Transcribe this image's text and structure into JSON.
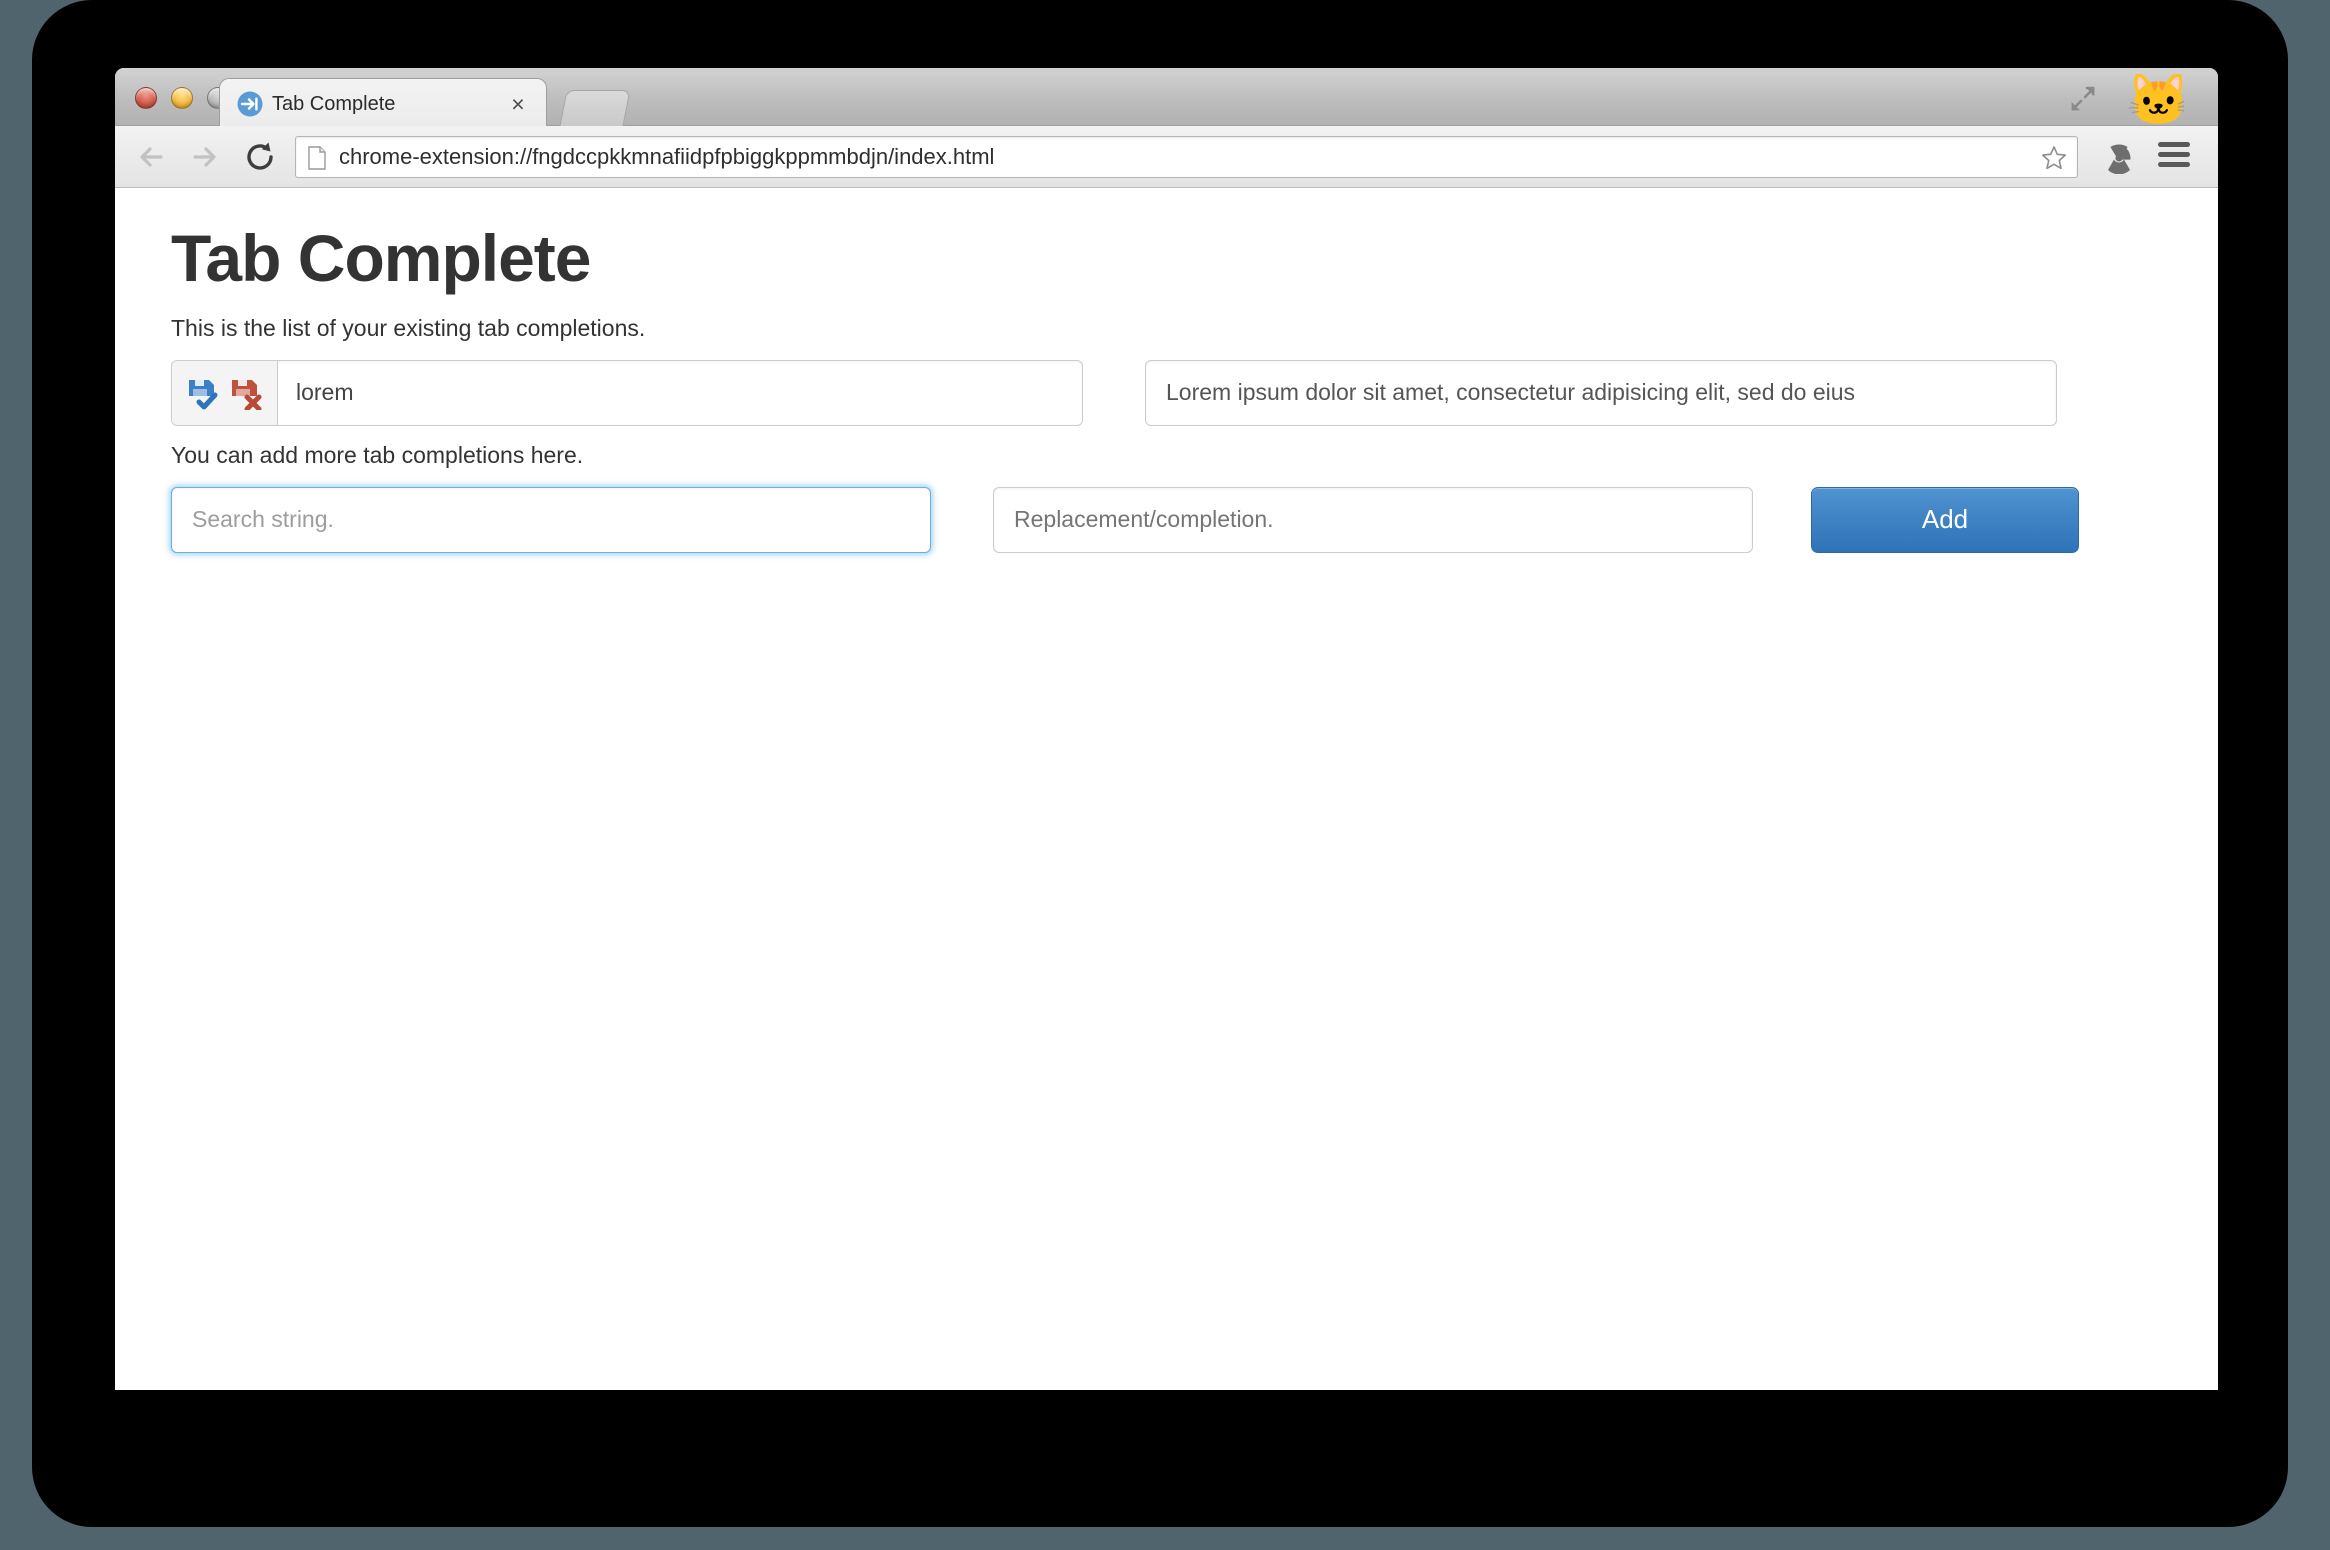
{
  "window": {
    "traffic_lights": [
      "close",
      "minimize",
      "zoom"
    ]
  },
  "tab": {
    "favicon": "tab-key-icon",
    "title": "Tab Complete",
    "close_label": "×",
    "new_tab_label": ""
  },
  "toolbar": {
    "back": "back-arrow-icon",
    "forward": "forward-arrow-icon",
    "reload": "reload-icon",
    "page_icon": "document-icon",
    "url": "chrome-extension://fngdccpkkmnafiidpfpbiggkppmmbdjn/index.html",
    "bookmark": "star-icon",
    "extension": "radiation-icon",
    "menu": "hamburger-menu-icon",
    "expand": "expand-arrows-icon",
    "avatar": "🐱"
  },
  "page": {
    "title": "Tab Complete",
    "existing_list_text": "This is the list of your existing tab completions.",
    "add_more_text": "You can add more tab completions here.",
    "existing_completions": [
      {
        "save_icon": "save-floppy-check-icon",
        "delete_icon": "delete-floppy-x-icon",
        "search": "lorem",
        "replacement": "Lorem ipsum dolor sit amet, consectetur adipisicing elit, sed do eius"
      }
    ],
    "new_completion": {
      "search_placeholder": "Search string.",
      "search_value": "",
      "replacement_placeholder": "Replacement/completion.",
      "replacement_value": "",
      "add_label": "Add"
    }
  },
  "colors": {
    "accent": "#3f83c4",
    "save_icon": "#3b7fc4",
    "delete_icon": "#c0513d",
    "focus_ring": "#64b0e8",
    "desktop_background": "#4f646c",
    "bezel": "#000000"
  }
}
